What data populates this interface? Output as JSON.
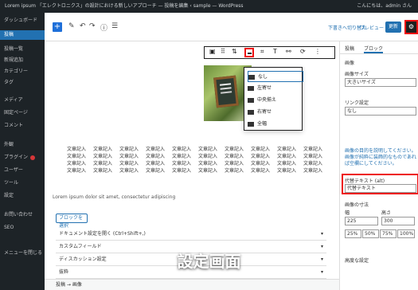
{
  "topbar": {
    "title": "Lorem ipsum 「エレクトロニクス」の設計における新しいアプローチ — 投稿を編集 ‹ sample — WordPress",
    "right": "こんにちは、admin さん"
  },
  "sidebar": {
    "items": [
      {
        "label": "ダッシュボード",
        "active": false
      },
      {
        "label": "投稿",
        "active": true
      },
      {
        "label": "投稿一覧",
        "active": false
      },
      {
        "label": "新規追加",
        "active": false
      },
      {
        "label": "カテゴリー",
        "active": false
      },
      {
        "label": "タグ",
        "active": false
      },
      {
        "label": "メディア",
        "active": false
      },
      {
        "label": "固定ページ",
        "active": false
      },
      {
        "label": "コメント",
        "active": false
      },
      {
        "label": "外観",
        "active": false
      },
      {
        "label": "プラグイン",
        "active": false
      },
      {
        "label": "ユーザー",
        "active": false
      },
      {
        "label": "ツール",
        "active": false
      },
      {
        "label": "設定",
        "active": false
      },
      {
        "label": "お問い合わせ",
        "active": false
      },
      {
        "label": "SEO",
        "active": false
      },
      {
        "label": "メニューを閉じる",
        "active": false
      }
    ]
  },
  "toolbar": {
    "draft": "下書きへ切り替え",
    "preview": "プレビュー",
    "publish": "更新"
  },
  "block_toolbar": {
    "icons": [
      "image-icon",
      "drag-icon",
      "align-icon",
      "crop-icon",
      "text-icon",
      "link-icon",
      "more-icon"
    ]
  },
  "dropdown": {
    "items": [
      {
        "label": "なし",
        "selected": true
      },
      {
        "label": "左寄せ",
        "selected": false
      },
      {
        "label": "中央揃え",
        "selected": false
      },
      {
        "label": "右寄せ",
        "selected": false
      },
      {
        "label": "全幅",
        "selected": false
      }
    ]
  },
  "textgrid": {
    "rows": [
      [
        "文章記入",
        "文章記入",
        "文章記入",
        "文章記入",
        "文章記入",
        "文章記入",
        "文章記入",
        "文章記入",
        "文章記入",
        "文章記入"
      ],
      [
        "文章記入",
        "文章記入",
        "文章記入",
        "文章記入",
        "文章記入",
        "文章記入",
        "文章記入",
        "文章記入",
        "文章記入",
        "文章記入"
      ],
      [
        "文章記入",
        "文章記入",
        "文章記入",
        "文章記入",
        "文章記入",
        "文章記入",
        "文章記入",
        "文章記入",
        "文章記入",
        "文章記入"
      ],
      [
        "文章記入",
        "文章記入",
        "文章記入",
        "文章記入",
        "文章記入",
        "文章記入",
        "文章記入",
        "文章記入",
        "文章記入",
        "文章記入"
      ]
    ]
  },
  "caption_line": "Lorem ipsum dolor sit amet, consectetur adipiscing",
  "select_btn": "ブロックを選択",
  "list": [
    "ドキュメント設定を開く (Ctrl+Shift+,)",
    "カスタムフィールド",
    "ディスカッション設定",
    "抜粋"
  ],
  "settings": {
    "tabs": [
      "投稿",
      "ブロック"
    ],
    "block_title": "画像",
    "alt_label": "代替テキスト (alt)",
    "alt_value": "代替テキスト",
    "image_size_label": "画像サイズ",
    "image_size_value": "大きいサイズ",
    "help_text": "画像の目的を説明してください。画像が純粋に装飾的なものであれば空欄にしてください。",
    "link_label": "リンク設定",
    "link_value": "なし",
    "dim_label": "画像の寸法",
    "width_label": "幅",
    "height_label": "高さ",
    "width_value": "225",
    "height_value": "300",
    "percents": [
      "25%",
      "50%",
      "75%",
      "100%"
    ],
    "advanced_label": "高度な設定"
  },
  "caption": "設定画面",
  "bottom_bar": "投稿 → 画像"
}
